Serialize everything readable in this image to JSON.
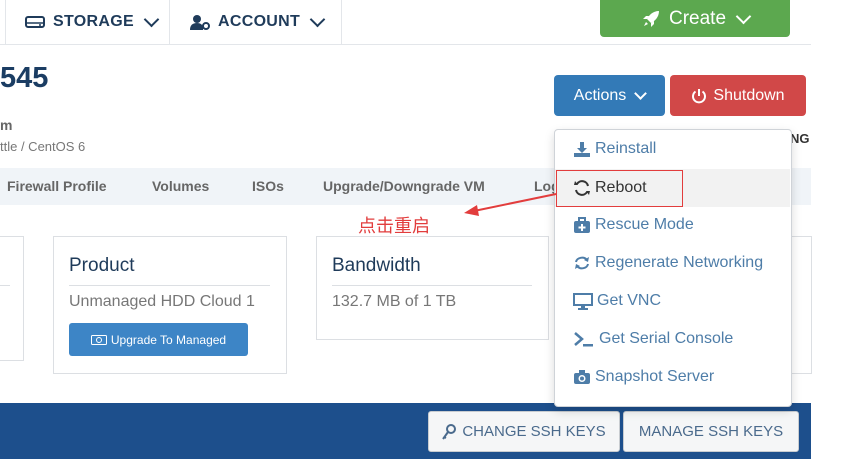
{
  "nav": {
    "storage": "STORAGE",
    "account": "ACCOUNT",
    "create": "Create"
  },
  "header": {
    "server_id": "545",
    "subtitle_1": "m",
    "subtitle_2": "ttle / CentOS 6",
    "status_fragment": "NG"
  },
  "buttons": {
    "actions": "Actions",
    "shutdown": "Shutdown"
  },
  "tabs": [
    "Firewall Profile",
    "Volumes",
    "ISOs",
    "Upgrade/Downgrade VM",
    "Log"
  ],
  "cards": {
    "product": {
      "title": "Product",
      "value": "Unmanaged HDD Cloud 1",
      "button": "Upgrade To Managed"
    },
    "bandwidth": {
      "title": "Bandwidth",
      "value": "132.7 MB of 1 TB"
    }
  },
  "dropdown": {
    "items": [
      "Reinstall",
      "Reboot",
      "Rescue Mode",
      "Regenerate Networking",
      "Get VNC",
      "Get Serial Console",
      "Snapshot Server"
    ],
    "icons": [
      "download-icon",
      "refresh-icon",
      "medkit-icon",
      "exchange-icon",
      "monitor-icon",
      "terminal-icon",
      "camera-icon"
    ]
  },
  "annotation": "点击重启",
  "bottom": {
    "change_ssh": "CHANGE SSH KEYS",
    "manage_ssh": "MANAGE SSH KEYS"
  },
  "colors": {
    "create_green": "#5ca84f",
    "actions_blue": "#337ab7",
    "shutdown_red": "#d14848",
    "bottom_blue": "#1d4f8c",
    "annotation_red": "#e23d3d"
  }
}
